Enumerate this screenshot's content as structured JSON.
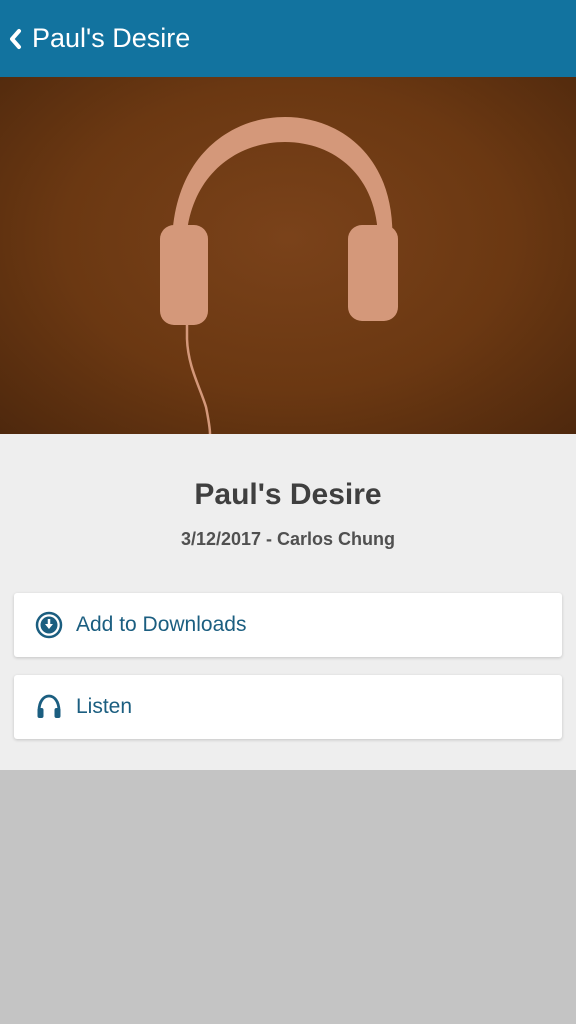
{
  "header": {
    "title": "Paul's Desire",
    "back_icon": "chevron-left-icon",
    "background": "#12739f"
  },
  "hero": {
    "image": "headphones-icon",
    "background": "#6b3812",
    "artwork_color": "#d4987a"
  },
  "sermon": {
    "title": "Paul's Desire",
    "date": "3/12/2017",
    "separator": " - ",
    "speaker": "Carlos Chung"
  },
  "actions": [
    {
      "label": "Add to Downloads",
      "icon": "download-circle-icon"
    },
    {
      "label": "Listen",
      "icon": "headphones-icon"
    }
  ],
  "colors": {
    "accent": "#1b5e80",
    "content_bg": "#eeeeee",
    "footer_bg": "#c4c4c4"
  }
}
